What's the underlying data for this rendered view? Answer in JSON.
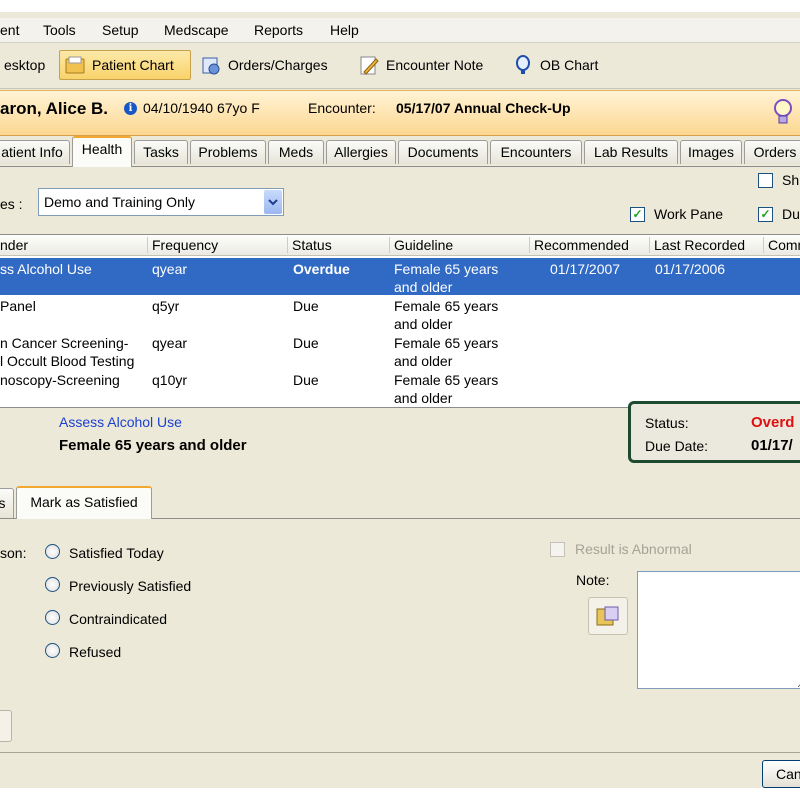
{
  "menu": [
    "ent",
    "Tools",
    "Setup",
    "Medscape",
    "Reports",
    "Help"
  ],
  "toolbar": {
    "buttons": [
      {
        "label": "esktop",
        "icon": "desktop-icon"
      },
      {
        "label": "Patient Chart",
        "icon": "folder-icon"
      },
      {
        "label": "Orders/Charges",
        "icon": "orders-icon"
      },
      {
        "label": "Encounter Note",
        "icon": "pencil-icon"
      },
      {
        "label": "OB Chart",
        "icon": "ob-chart-icon"
      }
    ]
  },
  "patient": {
    "name": "aron, Alice B.",
    "dob_age": "04/10/1940 67yo F",
    "encounter_label": "Encounter:",
    "encounter_value": "05/17/07 Annual Check-Up"
  },
  "tabs": [
    "atient Info",
    "Health",
    "Tasks",
    "Problems",
    "Meds",
    "Allergies",
    "Documents",
    "Encounters",
    "Lab Results",
    "Images",
    "Orders"
  ],
  "filter": {
    "label": "es :",
    "value": "Demo and Training Only",
    "checkboxes": [
      {
        "label": "Sh",
        "checked": false
      },
      {
        "label": "Work Pane",
        "checked": true
      },
      {
        "label": "Du",
        "checked": true
      }
    ]
  },
  "grid": {
    "headers": [
      "nder",
      "Frequency",
      "Status",
      "Guideline",
      "Recommended",
      "Last Recorded",
      "Comm"
    ],
    "rows": [
      {
        "name": "ss Alcohol Use",
        "freq": "qyear",
        "status": "Overdue",
        "guideline": "Female 65 years\nand older",
        "recommended": "01/17/2007",
        "last": "01/17/2006",
        "selected": true
      },
      {
        "name": "Panel",
        "freq": "q5yr",
        "status": "Due",
        "guideline": "Female 65 years\nand older",
        "recommended": "",
        "last": "",
        "selected": false
      },
      {
        "name": "n Cancer Screening-\nl Occult Blood Testing",
        "freq": "qyear",
        "status": "Due",
        "guideline": "Female 65 years\nand older",
        "recommended": "",
        "last": "",
        "selected": false
      },
      {
        "name": "noscopy-Screening",
        "freq": "q10yr",
        "status": "Due",
        "guideline": "Female 65 years\nand older",
        "recommended": "",
        "last": "",
        "selected": false
      }
    ]
  },
  "detail": {
    "title": "Assess Alcohol Use",
    "subtitle": "Female 65 years and older",
    "status_label": "Status:",
    "status_value": "Overd",
    "due_label": "Due Date:",
    "due_value": "01/17/"
  },
  "sub_tabs": [
    "s",
    "Mark as Satisfied"
  ],
  "satisfy": {
    "reason_label": "son:",
    "options": [
      "Satisfied Today",
      "Previously Satisfied",
      "Contraindicated",
      "Refused"
    ],
    "abnormal_label": "Result is Abnormal",
    "note_label": "Note:"
  },
  "footer": {
    "cancel_label": "Can"
  },
  "colors": {
    "selection": "#316ac5",
    "overdue": "#e01010",
    "link": "#1a3fd1",
    "patient_bar": "#fcd790"
  }
}
